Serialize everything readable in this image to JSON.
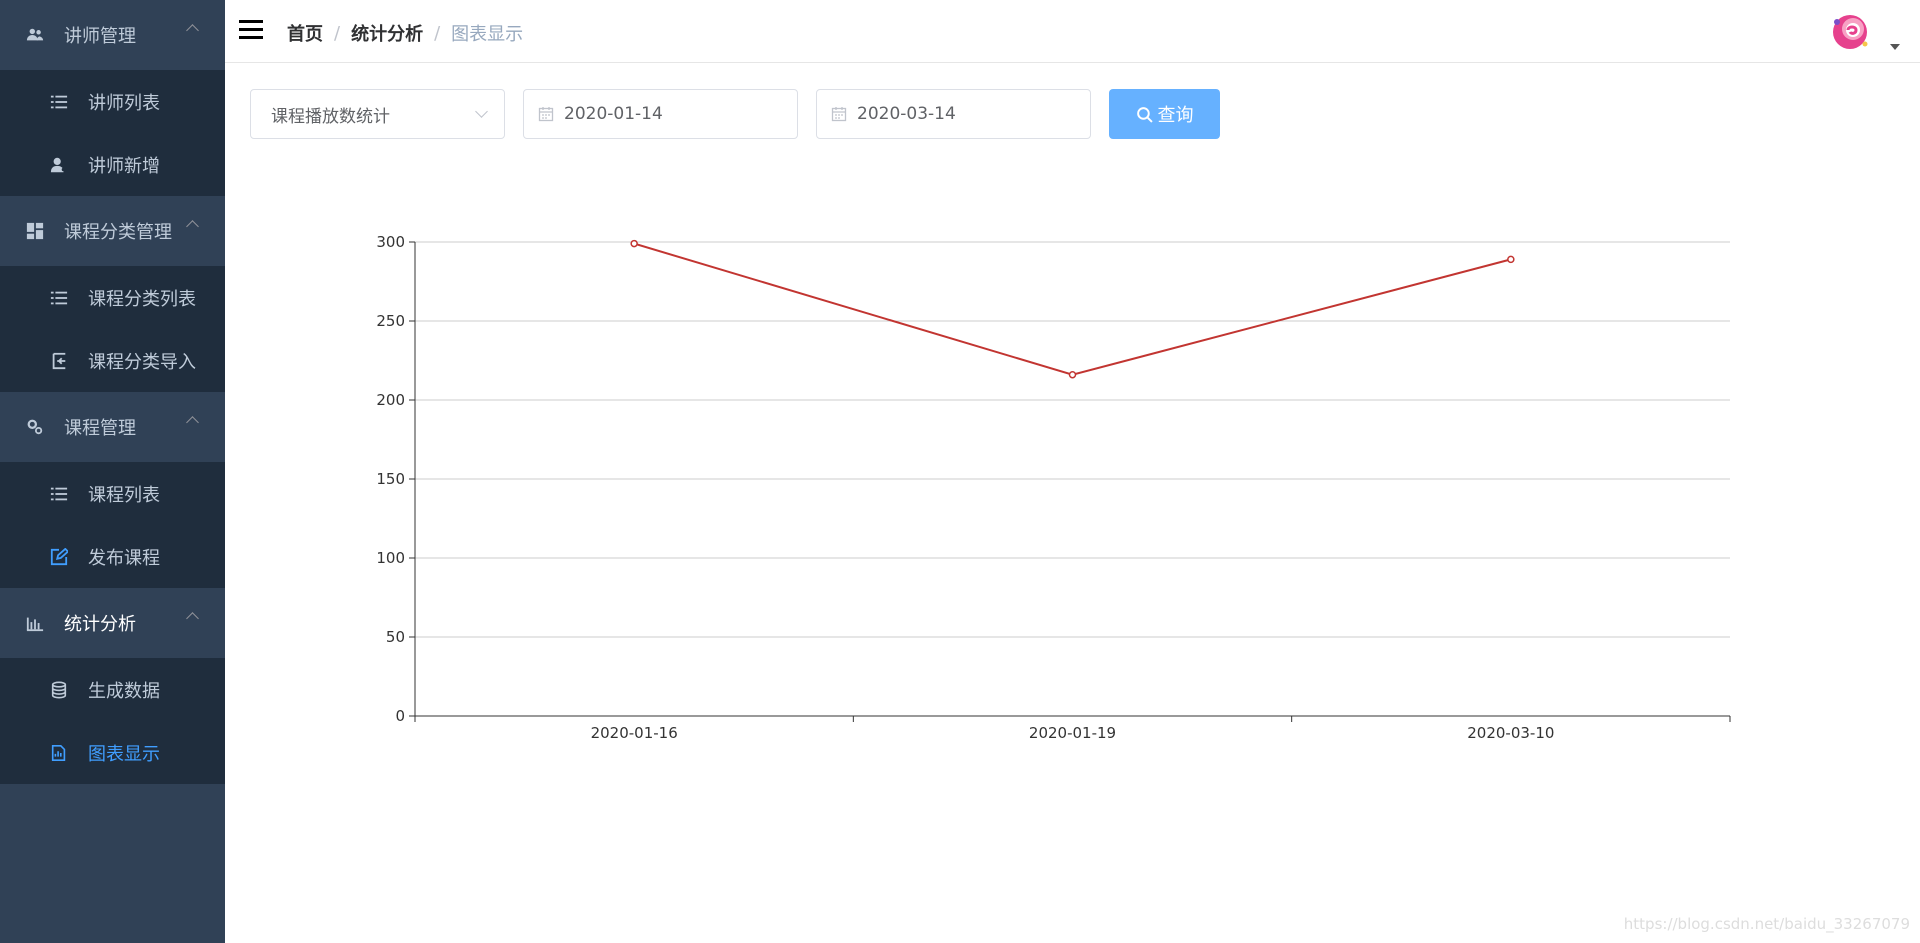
{
  "sidebar": {
    "groups": [
      {
        "title": "讲师管理",
        "icon": "users-icon",
        "items": [
          {
            "label": "讲师列表",
            "icon": "list-icon"
          },
          {
            "label": "讲师新增",
            "icon": "user-add-icon"
          }
        ]
      },
      {
        "title": "课程分类管理",
        "icon": "grid-icon",
        "items": [
          {
            "label": "课程分类列表",
            "icon": "list-icon"
          },
          {
            "label": "课程分类导入",
            "icon": "import-icon"
          }
        ]
      },
      {
        "title": "课程管理",
        "icon": "gears-icon",
        "items": [
          {
            "label": "课程列表",
            "icon": "list-icon"
          },
          {
            "label": "发布课程",
            "icon": "edit-icon"
          }
        ]
      },
      {
        "title": "统计分析",
        "icon": "bar-chart-icon",
        "items": [
          {
            "label": "生成数据",
            "icon": "database-icon"
          },
          {
            "label": "图表显示",
            "icon": "chart-doc-icon",
            "active": true
          }
        ]
      }
    ]
  },
  "header": {
    "breadcrumb": [
      "首页",
      "统计分析",
      "图表显示"
    ]
  },
  "form": {
    "type_select": "课程播放数统计",
    "begin_date": "2020-01-14",
    "end_date": "2020-03-14",
    "query_label": "查询"
  },
  "chart_data": {
    "type": "line",
    "x": [
      "2020-01-16",
      "2020-01-19",
      "2020-03-10"
    ],
    "series": [
      {
        "values": [
          299,
          216,
          289
        ],
        "color": "#c23531"
      }
    ],
    "ylim": [
      0,
      300
    ],
    "yticks": [
      0,
      50,
      100,
      150,
      200,
      250,
      300
    ],
    "grid": true
  },
  "watermark": "https://blog.csdn.net/baidu_33267079"
}
